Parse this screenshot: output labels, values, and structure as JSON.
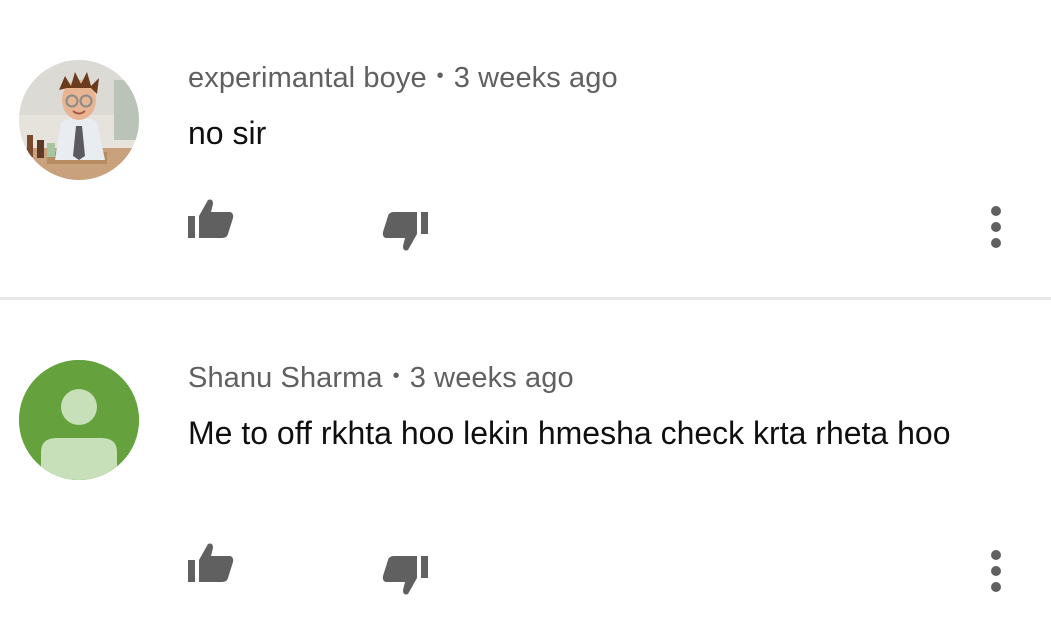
{
  "comments": [
    {
      "author": "experimantal boye",
      "separator": "•",
      "time": "3 weeks ago",
      "text": "no sir",
      "avatar_icon": "boy-scientist-photo"
    },
    {
      "author": "Shanu Sharma",
      "separator": "•",
      "time": "3 weeks ago",
      "text": "Me to off rkhta hoo lekin hmesha check krta rheta hoo",
      "avatar_icon": "default-user-icon",
      "avatar_color": "#65a23d"
    }
  ],
  "colors": {
    "icon": "#606060",
    "meta_text": "#606060",
    "body_text": "#0f0f0f",
    "divider": "#e7e7e7"
  }
}
